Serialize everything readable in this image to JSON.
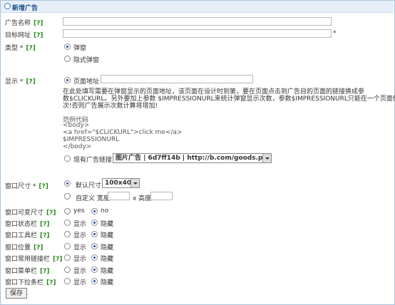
{
  "header": {
    "title": "新增广告"
  },
  "help_mark": "[?]",
  "fields": {
    "name_label": "广告名称",
    "url_label": "目标网址",
    "url_required": "*",
    "type_label": "类型 *",
    "type_options": [
      "弹窗",
      "隐式弹窗"
    ],
    "display_label": "显示 *",
    "display_page_option": "页面地址",
    "display_desc": [
      "在此处填写需要在弹窗显示的页面地址，该页面在设计时到第，要在页面点击到广告目的页面的链接换成参",
      "数$CLICKURL。另外要加上参数 $IMPRESSIONURL来统计弹窗显示次数，参数$IMPRESSIONURL只能在一个页面使用一",
      "次!否则广告展示次数计算将增加!"
    ],
    "sample_title": "范例代码",
    "sample_code": [
      "<body>",
      "<a href=\"$CLICKURL\">click me</a>",
      "$IMPRESSIONURL",
      "</body>"
    ],
    "existing_link_option": "现有广告链接",
    "existing_link_value": "图片广告 | 6d7ff14b | http://b.com/goods.php?id=13",
    "window_size_label": "窗口尺寸 *",
    "size_default_option": "默认尺寸",
    "size_default_value": "100x40",
    "size_custom_option": "自定义 宽度",
    "size_height_label": "x 高度",
    "resizable_label": "窗口可变尺寸",
    "resizable_yes": "yes",
    "resizable_no": "no",
    "show_option": "显示",
    "hide_option": "隐藏",
    "statusbar_label": "窗口状态栏",
    "toolbar_label": "窗口工具栏",
    "location_label": "窗口位置",
    "links_label": "窗口常用链接栏",
    "menubar_label": "窗口菜单栏",
    "scrollbar_label": "窗口下拉条栏",
    "save_button": "保存"
  }
}
